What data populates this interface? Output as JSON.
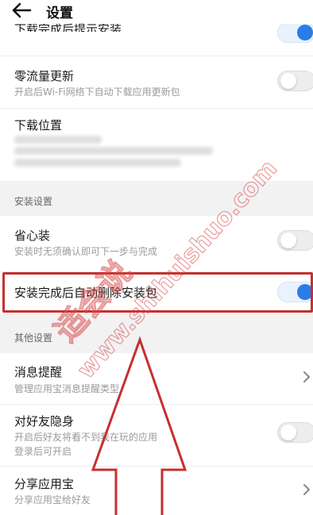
{
  "header": {
    "title": "设置",
    "back_icon": "arrow-left-icon"
  },
  "download": {
    "prev_item_fragment": "下载完成后提示安装",
    "zero_traffic": {
      "title": "零流量更新",
      "subtitle": "开启后Wi-Fi网络下自动下载应用更新包"
    },
    "location": {
      "title": "下载位置"
    }
  },
  "install_section": {
    "label": "安装设置",
    "worry_free": {
      "title": "省心装",
      "subtitle": "安装时无须确认即可下一步与完成"
    },
    "auto_delete": {
      "title": "安装完成后自动删除安装包"
    }
  },
  "other_section": {
    "label": "其他设置",
    "notifications": {
      "title": "消息提醒",
      "subtitle": "管理应用宝消息提醒类型"
    },
    "invisible": {
      "title": "对好友隐身",
      "subtitle": "开启后好友将看不到我在玩的应用",
      "subtitle2": "登录后可开启"
    },
    "share": {
      "title": "分享应用宝",
      "subtitle": "分享应用宝给好友"
    }
  },
  "watermark": {
    "line1": "适会说",
    "line2": "www.shihuishuo.com"
  },
  "colors": {
    "accent": "#2a7de9",
    "annotation": "#c5302f"
  }
}
